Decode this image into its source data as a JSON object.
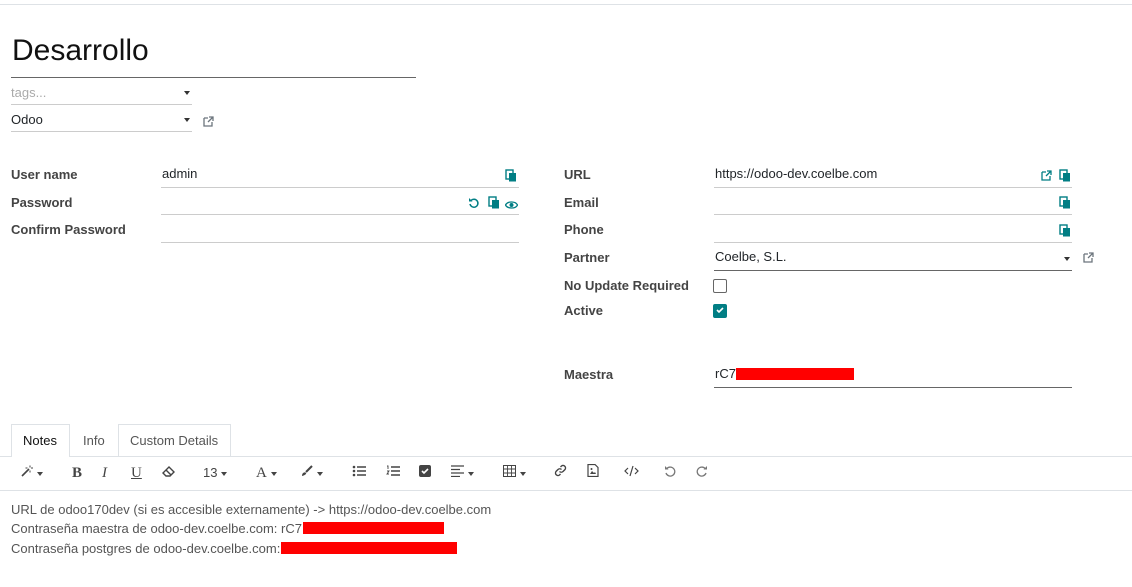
{
  "record": {
    "title": "Desarrollo",
    "tags_placeholder": "tags...",
    "instance_type": "Odoo"
  },
  "left_fields": {
    "username_label": "User name",
    "username_value": "admin",
    "password_label": "Password",
    "confirm_label": "Confirm Password"
  },
  "right_fields": {
    "url_label": "URL",
    "url_value": "https://odoo-dev.coelbe.com",
    "email_label": "Email",
    "phone_label": "Phone",
    "partner_label": "Partner",
    "partner_value": "Coelbe, S.L.",
    "no_update_label": "No Update Required",
    "no_update_checked": false,
    "active_label": "Active",
    "active_checked": true,
    "maestra_label": "Maestra",
    "maestra_value": "rC7"
  },
  "tabs": [
    "Notes",
    "Info",
    "Custom Details"
  ],
  "toolbar": {
    "font_size": "13"
  },
  "notes": {
    "line1": "URL de odoo170dev (si es accesible externamente) -> https://odoo-dev.coelbe.com",
    "line2": "Contraseña maestra de odoo-dev.coelbe.com: rC7",
    "line3": "Contraseña postgres de odoo-dev.coelbe.com:"
  },
  "colors": {
    "accent": "#017e84",
    "redaction": "#ff0000"
  }
}
